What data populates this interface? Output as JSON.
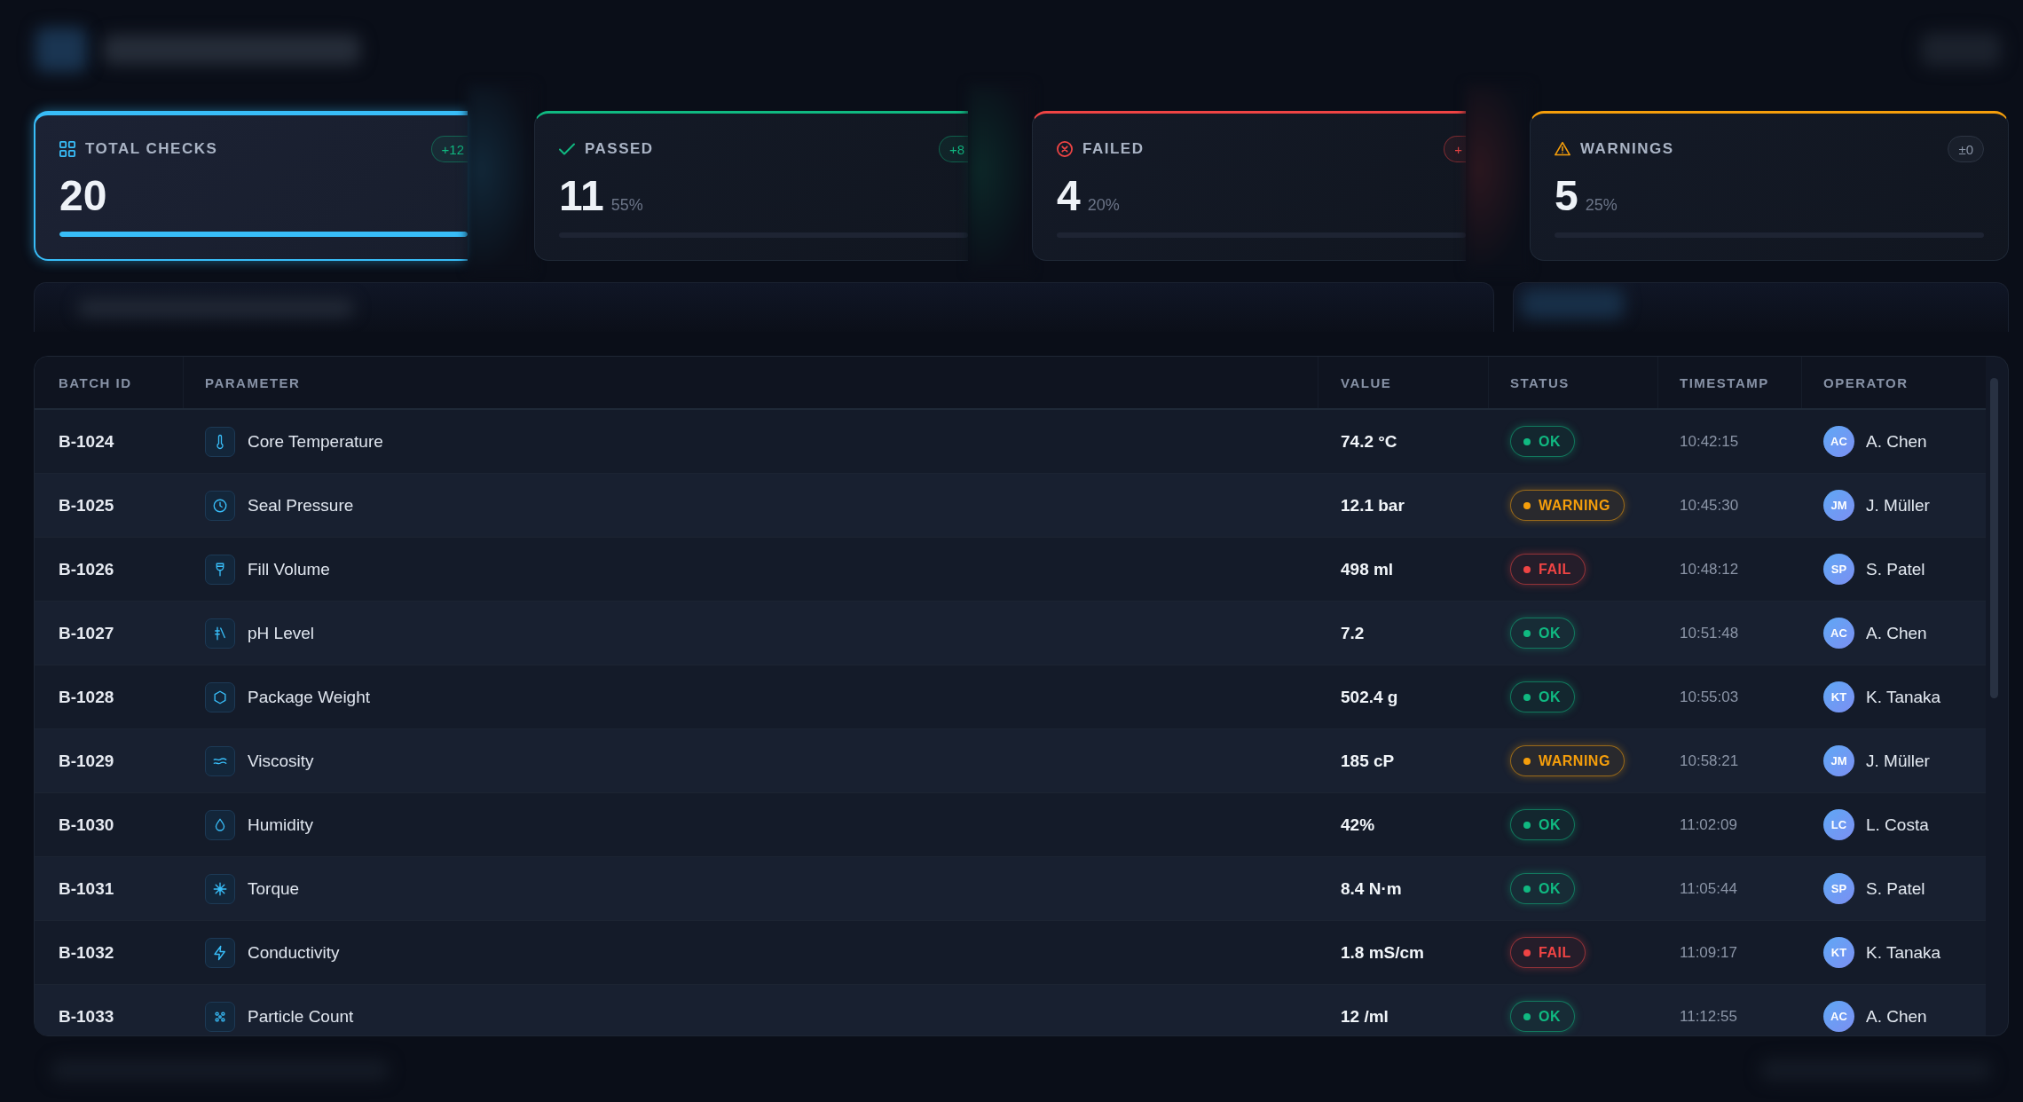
{
  "summary_cards": [
    {
      "kind": "total",
      "label": "TOTAL CHECKS",
      "value": "20",
      "color": "#38bdf8",
      "selected": true,
      "badge": {
        "text": "+12",
        "kind": "good"
      },
      "level": 1
    },
    {
      "kind": "passed",
      "label": "PASSED",
      "value": "11",
      "percent": "55%",
      "color": "#10b981",
      "selected": false,
      "badge": {
        "text": "+8",
        "kind": "good"
      },
      "level": 0
    },
    {
      "kind": "failed",
      "label": "FAILED",
      "value": "4",
      "percent": "20%",
      "color": "#ef4444",
      "selected": false,
      "badge": {
        "text": "+",
        "kind": "bad"
      },
      "level": 0
    },
    {
      "kind": "warnings",
      "label": "WARNINGS",
      "value": "5",
      "percent": "25%",
      "color": "#f59e0b",
      "selected": false,
      "badge": {
        "text": "±0",
        "kind": "neutral"
      },
      "level": 0
    }
  ],
  "table": {
    "columns": [
      "BATCH ID",
      "PARAMETER",
      "VALUE",
      "STATUS",
      "TIMESTAMP",
      "OPERATOR"
    ],
    "rows": [
      {
        "batch_id": "B-1024",
        "parameter": "Core Temperature",
        "value": "74.2 °C",
        "status": {
          "text": "OK",
          "kind": "ok"
        },
        "timestamp": "10:42:15",
        "operator": {
          "initials": "AC",
          "name": "A. Chen"
        }
      },
      {
        "batch_id": "B-1025",
        "parameter": "Seal Pressure",
        "value": "12.1 bar",
        "status": {
          "text": "WARNING",
          "kind": "warning"
        },
        "timestamp": "10:45:30",
        "operator": {
          "initials": "JM",
          "name": "J. Müller"
        }
      },
      {
        "batch_id": "B-1026",
        "parameter": "Fill Volume",
        "value": "498 ml",
        "status": {
          "text": "FAIL",
          "kind": "fail"
        },
        "timestamp": "10:48:12",
        "operator": {
          "initials": "SP",
          "name": "S. Patel"
        }
      },
      {
        "batch_id": "B-1027",
        "parameter": "pH Level",
        "value": "7.2",
        "status": {
          "text": "OK",
          "kind": "ok"
        },
        "timestamp": "10:51:48",
        "operator": {
          "initials": "AC",
          "name": "A. Chen"
        }
      },
      {
        "batch_id": "B-1028",
        "parameter": "Package Weight",
        "value": "502.4 g",
        "status": {
          "text": "OK",
          "kind": "ok"
        },
        "timestamp": "10:55:03",
        "operator": {
          "initials": "KT",
          "name": "K. Tanaka"
        }
      },
      {
        "batch_id": "B-1029",
        "parameter": "Viscosity",
        "value": "185 cP",
        "status": {
          "text": "WARNING",
          "kind": "warning"
        },
        "timestamp": "10:58:21",
        "operator": {
          "initials": "JM",
          "name": "J. Müller"
        }
      },
      {
        "batch_id": "B-1030",
        "parameter": "Humidity",
        "value": "42%",
        "status": {
          "text": "OK",
          "kind": "ok"
        },
        "timestamp": "11:02:09",
        "operator": {
          "initials": "LC",
          "name": "L. Costa"
        }
      },
      {
        "batch_id": "B-1031",
        "parameter": "Torque",
        "value": "8.4 N·m",
        "status": {
          "text": "OK",
          "kind": "ok"
        },
        "timestamp": "11:05:44",
        "operator": {
          "initials": "SP",
          "name": "S. Patel"
        }
      },
      {
        "batch_id": "B-1032",
        "parameter": "Conductivity",
        "value": "1.8 mS/cm",
        "status": {
          "text": "FAIL",
          "kind": "fail"
        },
        "timestamp": "11:09:17",
        "operator": {
          "initials": "KT",
          "name": "K. Tanaka"
        }
      },
      {
        "batch_id": "B-1033",
        "parameter": "Particle Count",
        "value": "12 /ml",
        "status": {
          "text": "OK",
          "kind": "ok"
        },
        "timestamp": "11:12:55",
        "operator": {
          "initials": "AC",
          "name": "A. Chen"
        }
      }
    ]
  }
}
